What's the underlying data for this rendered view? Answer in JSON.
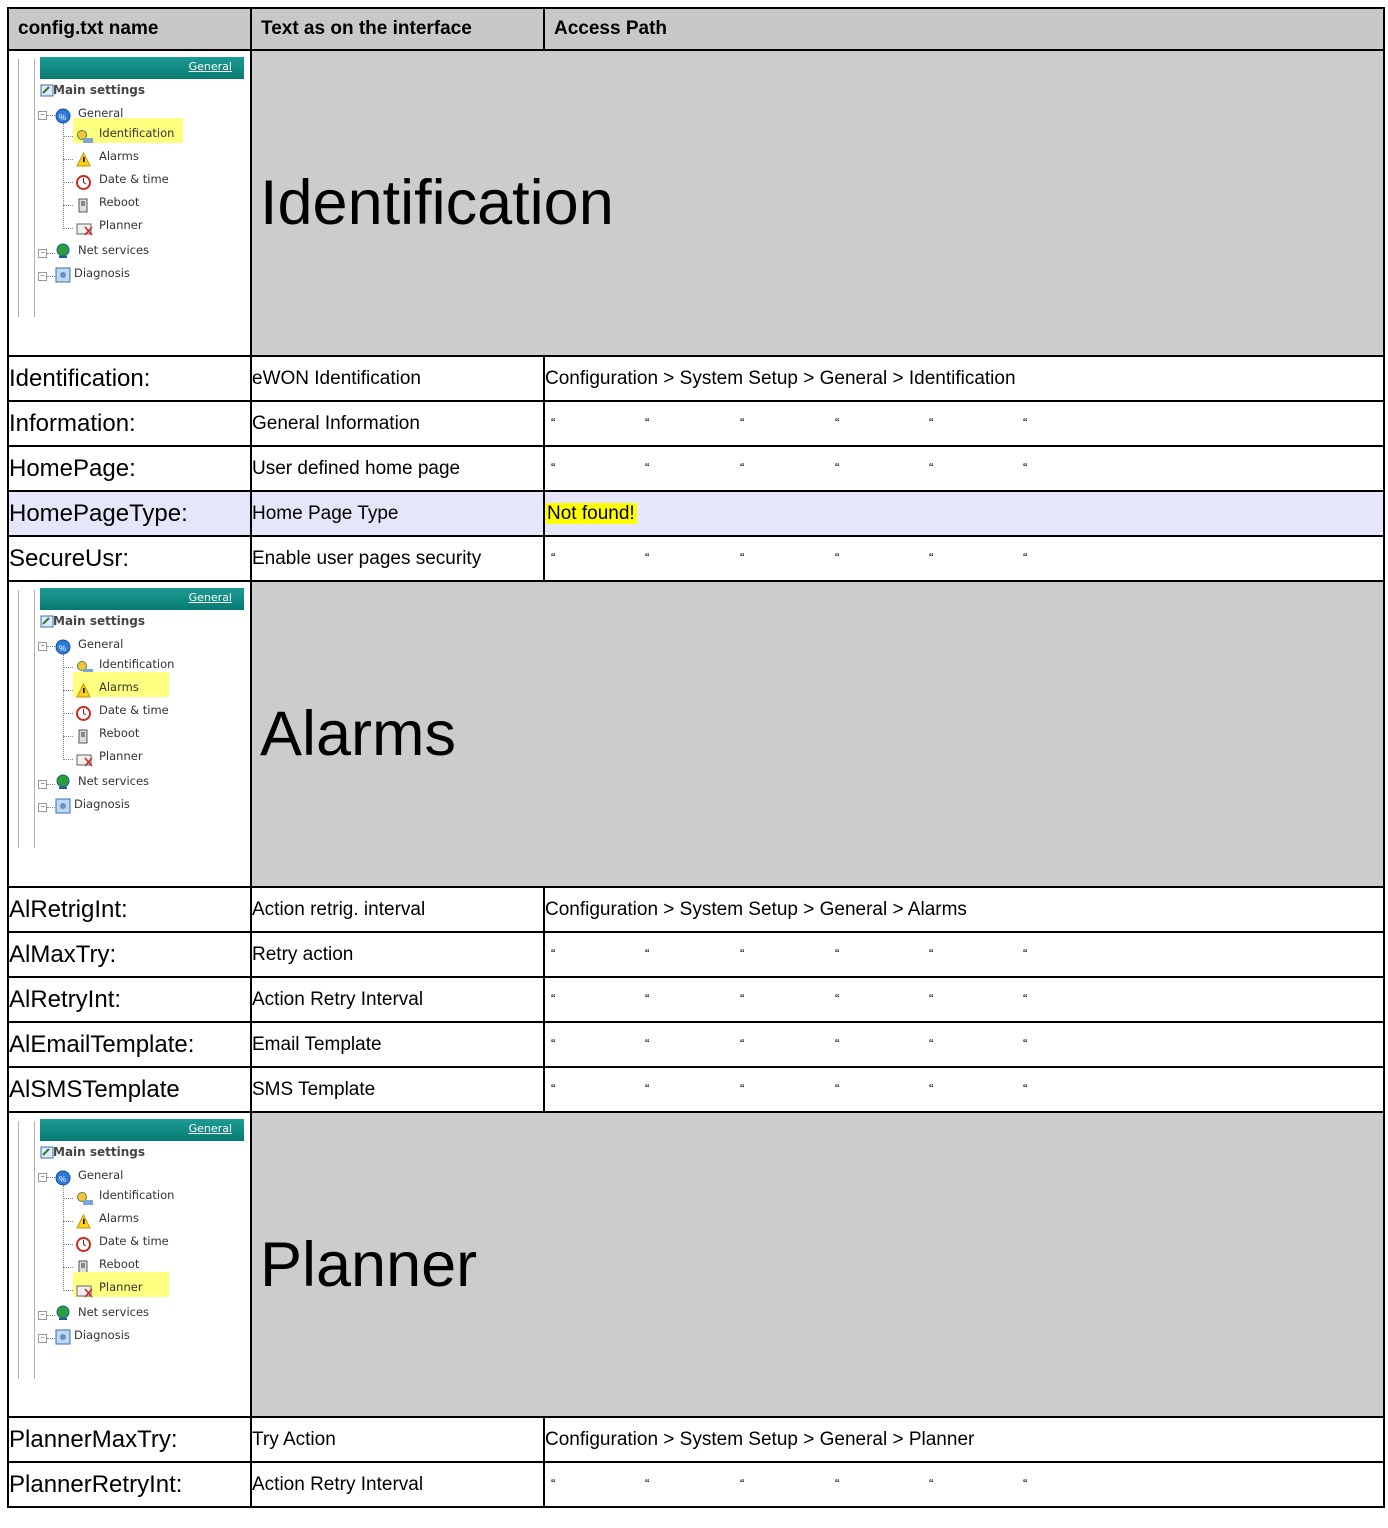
{
  "headers": {
    "col1": "config.txt name",
    "col2": "Text as on the interface",
    "col3": "Access Path"
  },
  "tree": {
    "link": "General",
    "main": "Main settings",
    "general": "General",
    "identification": "Identification",
    "alarms": "Alarms",
    "datetime": "Date & time",
    "reboot": "Reboot",
    "planner": "Planner",
    "net": "Net services",
    "diag": "Diagnosis"
  },
  "ditto_mark": "“",
  "sections": [
    {
      "title": "Identification",
      "highlight": "identification",
      "rows": [
        {
          "name": "Identification:",
          "iface": "eWON Identification",
          "path": "Configuration > System Setup > General > Identification"
        },
        {
          "name": "Information:",
          "iface": "General Information",
          "path": null
        },
        {
          "name": "HomePage:",
          "iface": "User defined home page",
          "path": null
        },
        {
          "name": "HomePageType:",
          "iface": "Home Page Type",
          "path": "Not found!",
          "notfound": true
        },
        {
          "name": "SecureUsr:",
          "iface": "Enable user pages security",
          "path": null
        }
      ]
    },
    {
      "title": "Alarms",
      "highlight": "alarms",
      "rows": [
        {
          "name": "AlRetrigInt:",
          "iface": "Action retrig. interval",
          "path": "Configuration > System Setup > General > Alarms"
        },
        {
          "name": "AlMaxTry:",
          "iface": "Retry action",
          "path": null
        },
        {
          "name": "AlRetryInt:",
          "iface": "Action Retry Interval",
          "path": null
        },
        {
          "name": "AlEmailTemplate:",
          "iface": "Email Template",
          "path": null
        },
        {
          "name": "AlSMSTemplate",
          "iface": "SMS Template",
          "path": null
        }
      ]
    },
    {
      "title": "Planner",
      "highlight": "planner",
      "rows": [
        {
          "name": "PlannerMaxTry:",
          "iface": "Try Action",
          "path": "Configuration > System Setup > General > Planner"
        },
        {
          "name": "PlannerRetryInt:",
          "iface": "Action Retry Interval",
          "path": null
        }
      ]
    }
  ]
}
